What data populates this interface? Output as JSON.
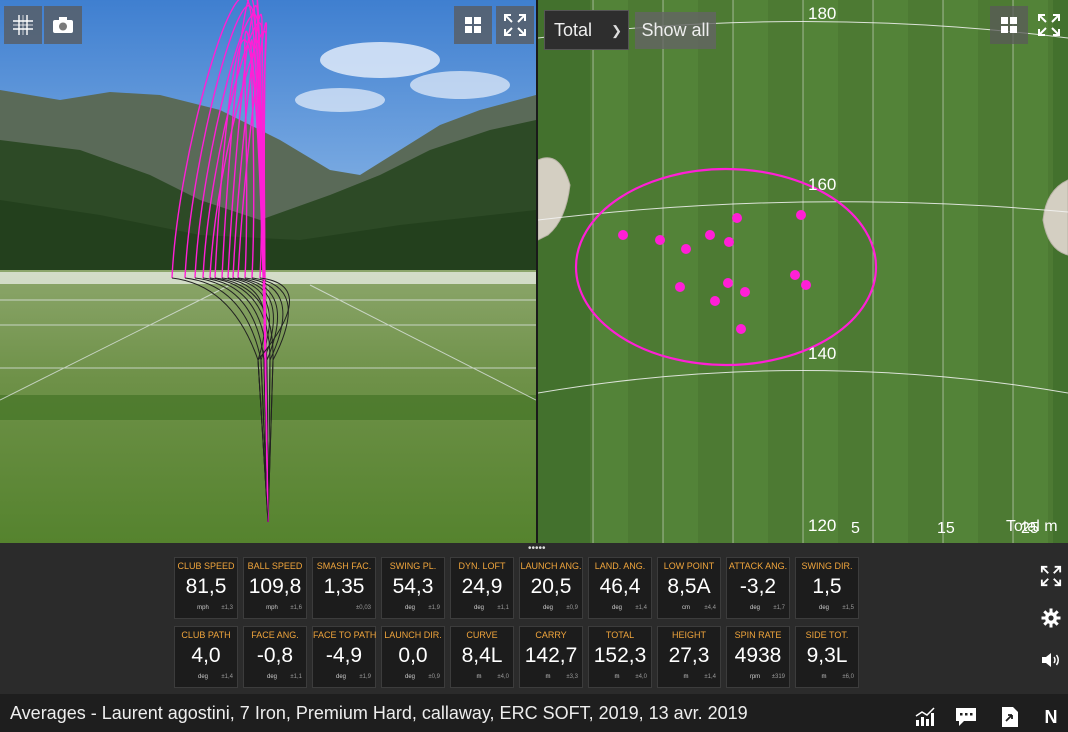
{
  "left_view": {
    "buttons": [
      {
        "name": "grid-toggle-button",
        "icon": "grid-icon"
      },
      {
        "name": "camera-button",
        "icon": "camera-icon"
      },
      {
        "name": "layout-button",
        "icon": "layout-grid-icon"
      },
      {
        "name": "fullscreen-button",
        "icon": "expand-icon"
      }
    ]
  },
  "right_view": {
    "select_value": "Total",
    "show_all_label": "Show all",
    "yard_labels": [
      "180",
      "160",
      "140",
      "120"
    ],
    "axis_labels": [
      "5",
      "15",
      "25"
    ],
    "axis_unit": "Total m",
    "dispersion_color": "#ff1fd6"
  },
  "metrics_row1": [
    {
      "label": "CLUB SPEED",
      "value": "81,5",
      "unit": "mph",
      "sd": "±1,3"
    },
    {
      "label": "BALL SPEED",
      "value": "109,8",
      "unit": "mph",
      "sd": "±1,6"
    },
    {
      "label": "SMASH FAC.",
      "value": "1,35",
      "unit": "",
      "sd": "±0,03"
    },
    {
      "label": "SWING PL.",
      "value": "54,3",
      "unit": "deg",
      "sd": "±1,9"
    },
    {
      "label": "DYN. LOFT",
      "value": "24,9",
      "unit": "deg",
      "sd": "±1,1"
    },
    {
      "label": "LAUNCH ANG.",
      "value": "20,5",
      "unit": "deg",
      "sd": "±0,9"
    },
    {
      "label": "LAND. ANG.",
      "value": "46,4",
      "unit": "deg",
      "sd": "±1,4"
    },
    {
      "label": "LOW POINT",
      "value": "8,5A",
      "unit": "cm",
      "sd": "±4,4"
    },
    {
      "label": "ATTACK ANG.",
      "value": "-3,2",
      "unit": "deg",
      "sd": "±1,7"
    },
    {
      "label": "SWING DIR.",
      "value": "1,5",
      "unit": "deg",
      "sd": "±1,5"
    }
  ],
  "metrics_row2": [
    {
      "label": "CLUB PATH",
      "value": "4,0",
      "unit": "deg",
      "sd": "±1,4"
    },
    {
      "label": "FACE ANG.",
      "value": "-0,8",
      "unit": "deg",
      "sd": "±1,1"
    },
    {
      "label": "FACE TO PATH",
      "value": "-4,9",
      "unit": "deg",
      "sd": "±1,9"
    },
    {
      "label": "LAUNCH DIR.",
      "value": "0,0",
      "unit": "deg",
      "sd": "±0,9"
    },
    {
      "label": "CURVE",
      "value": "8,4L",
      "unit": "m",
      "sd": "±4,0"
    },
    {
      "label": "CARRY",
      "value": "142,7",
      "unit": "m",
      "sd": "±3,3"
    },
    {
      "label": "TOTAL",
      "value": "152,3",
      "unit": "m",
      "sd": "±4,0"
    },
    {
      "label": "HEIGHT",
      "value": "27,3",
      "unit": "m",
      "sd": "±1,4"
    },
    {
      "label": "SPIN RATE",
      "value": "4938",
      "unit": "rpm",
      "sd": "±319"
    },
    {
      "label": "SIDE TOT.",
      "value": "9,3L",
      "unit": "m",
      "sd": "±6,0"
    }
  ],
  "side_icons": [
    "expand-icon",
    "gear-icon",
    "speaker-icon"
  ],
  "status": {
    "text": "Averages - Laurent agostini, 7 Iron, Premium Hard, callaway, ERC SOFT, 2019, 13 avr. 2019",
    "north_label": "N",
    "icons": [
      "chart-icon",
      "comment-icon",
      "export-icon",
      "north-icon"
    ]
  },
  "colors": {
    "label_orange": "#f0a53c",
    "trace_magenta": "#ff1fd6",
    "panel_bg": "#2b2b2b"
  }
}
